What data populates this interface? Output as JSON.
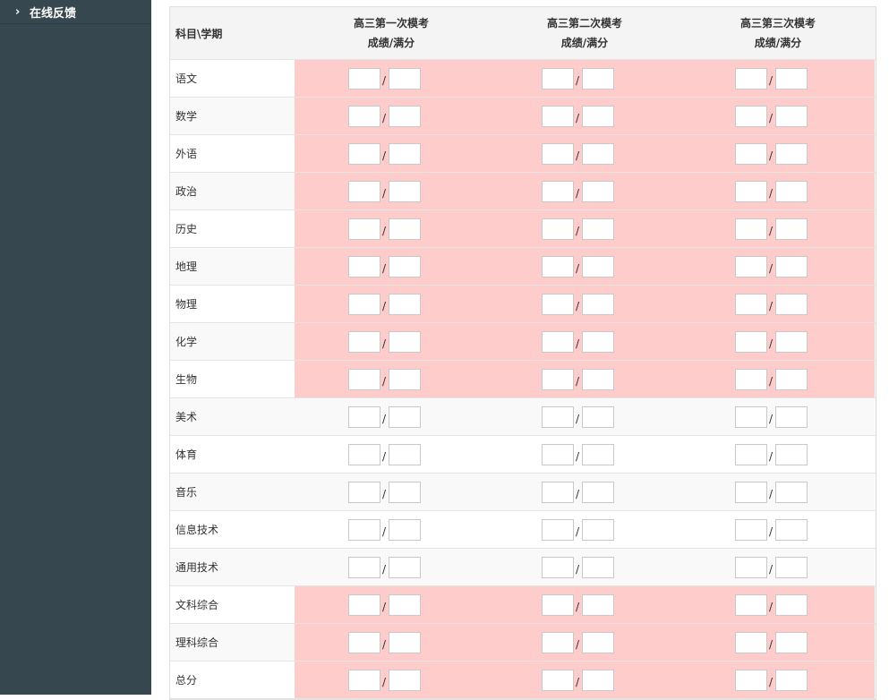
{
  "sidebar": {
    "items": [
      {
        "label": "在线反馈",
        "icon": "chevron-right-icon"
      }
    ]
  },
  "table": {
    "corner_header": "科目\\学期",
    "columns": [
      {
        "line1": "高三第一次模考",
        "line2": "成绩/满分"
      },
      {
        "line1": "高三第二次模考",
        "line2": "成绩/满分"
      },
      {
        "line1": "高三第三次模考",
        "line2": "成绩/满分"
      }
    ],
    "separator": "/",
    "rows": [
      {
        "subject": "语文",
        "highlight": true,
        "scores": [
          [
            "",
            ""
          ],
          [
            "",
            ""
          ],
          [
            "",
            ""
          ]
        ]
      },
      {
        "subject": "数学",
        "highlight": true,
        "scores": [
          [
            "",
            ""
          ],
          [
            "",
            ""
          ],
          [
            "",
            ""
          ]
        ]
      },
      {
        "subject": "外语",
        "highlight": true,
        "scores": [
          [
            "",
            ""
          ],
          [
            "",
            ""
          ],
          [
            "",
            ""
          ]
        ]
      },
      {
        "subject": "政治",
        "highlight": true,
        "scores": [
          [
            "",
            ""
          ],
          [
            "",
            ""
          ],
          [
            "",
            ""
          ]
        ]
      },
      {
        "subject": "历史",
        "highlight": true,
        "scores": [
          [
            "",
            ""
          ],
          [
            "",
            ""
          ],
          [
            "",
            ""
          ]
        ]
      },
      {
        "subject": "地理",
        "highlight": true,
        "scores": [
          [
            "",
            ""
          ],
          [
            "",
            ""
          ],
          [
            "",
            ""
          ]
        ]
      },
      {
        "subject": "物理",
        "highlight": true,
        "scores": [
          [
            "",
            ""
          ],
          [
            "",
            ""
          ],
          [
            "",
            ""
          ]
        ]
      },
      {
        "subject": "化学",
        "highlight": true,
        "scores": [
          [
            "",
            ""
          ],
          [
            "",
            ""
          ],
          [
            "",
            ""
          ]
        ]
      },
      {
        "subject": "生物",
        "highlight": true,
        "scores": [
          [
            "",
            ""
          ],
          [
            "",
            ""
          ],
          [
            "",
            ""
          ]
        ]
      },
      {
        "subject": "美术",
        "highlight": false,
        "scores": [
          [
            "",
            ""
          ],
          [
            "",
            ""
          ],
          [
            "",
            ""
          ]
        ]
      },
      {
        "subject": "体育",
        "highlight": false,
        "scores": [
          [
            "",
            ""
          ],
          [
            "",
            ""
          ],
          [
            "",
            ""
          ]
        ]
      },
      {
        "subject": "音乐",
        "highlight": false,
        "scores": [
          [
            "",
            ""
          ],
          [
            "",
            ""
          ],
          [
            "",
            ""
          ]
        ]
      },
      {
        "subject": "信息技术",
        "highlight": false,
        "scores": [
          [
            "",
            ""
          ],
          [
            "",
            ""
          ],
          [
            "",
            ""
          ]
        ]
      },
      {
        "subject": "通用技术",
        "highlight": false,
        "scores": [
          [
            "",
            ""
          ],
          [
            "",
            ""
          ],
          [
            "",
            ""
          ]
        ]
      },
      {
        "subject": "文科综合",
        "highlight": true,
        "scores": [
          [
            "",
            ""
          ],
          [
            "",
            ""
          ],
          [
            "",
            ""
          ]
        ]
      },
      {
        "subject": "理科综合",
        "highlight": true,
        "scores": [
          [
            "",
            ""
          ],
          [
            "",
            ""
          ],
          [
            "",
            ""
          ]
        ]
      },
      {
        "subject": "总分",
        "highlight": true,
        "scores": [
          [
            "",
            ""
          ],
          [
            "",
            ""
          ],
          [
            "",
            ""
          ]
        ]
      }
    ]
  },
  "colors": {
    "sidebar_bg": "#37474f",
    "highlight_bg": "#ffcccc",
    "header_bg": "#f4f4f4"
  }
}
